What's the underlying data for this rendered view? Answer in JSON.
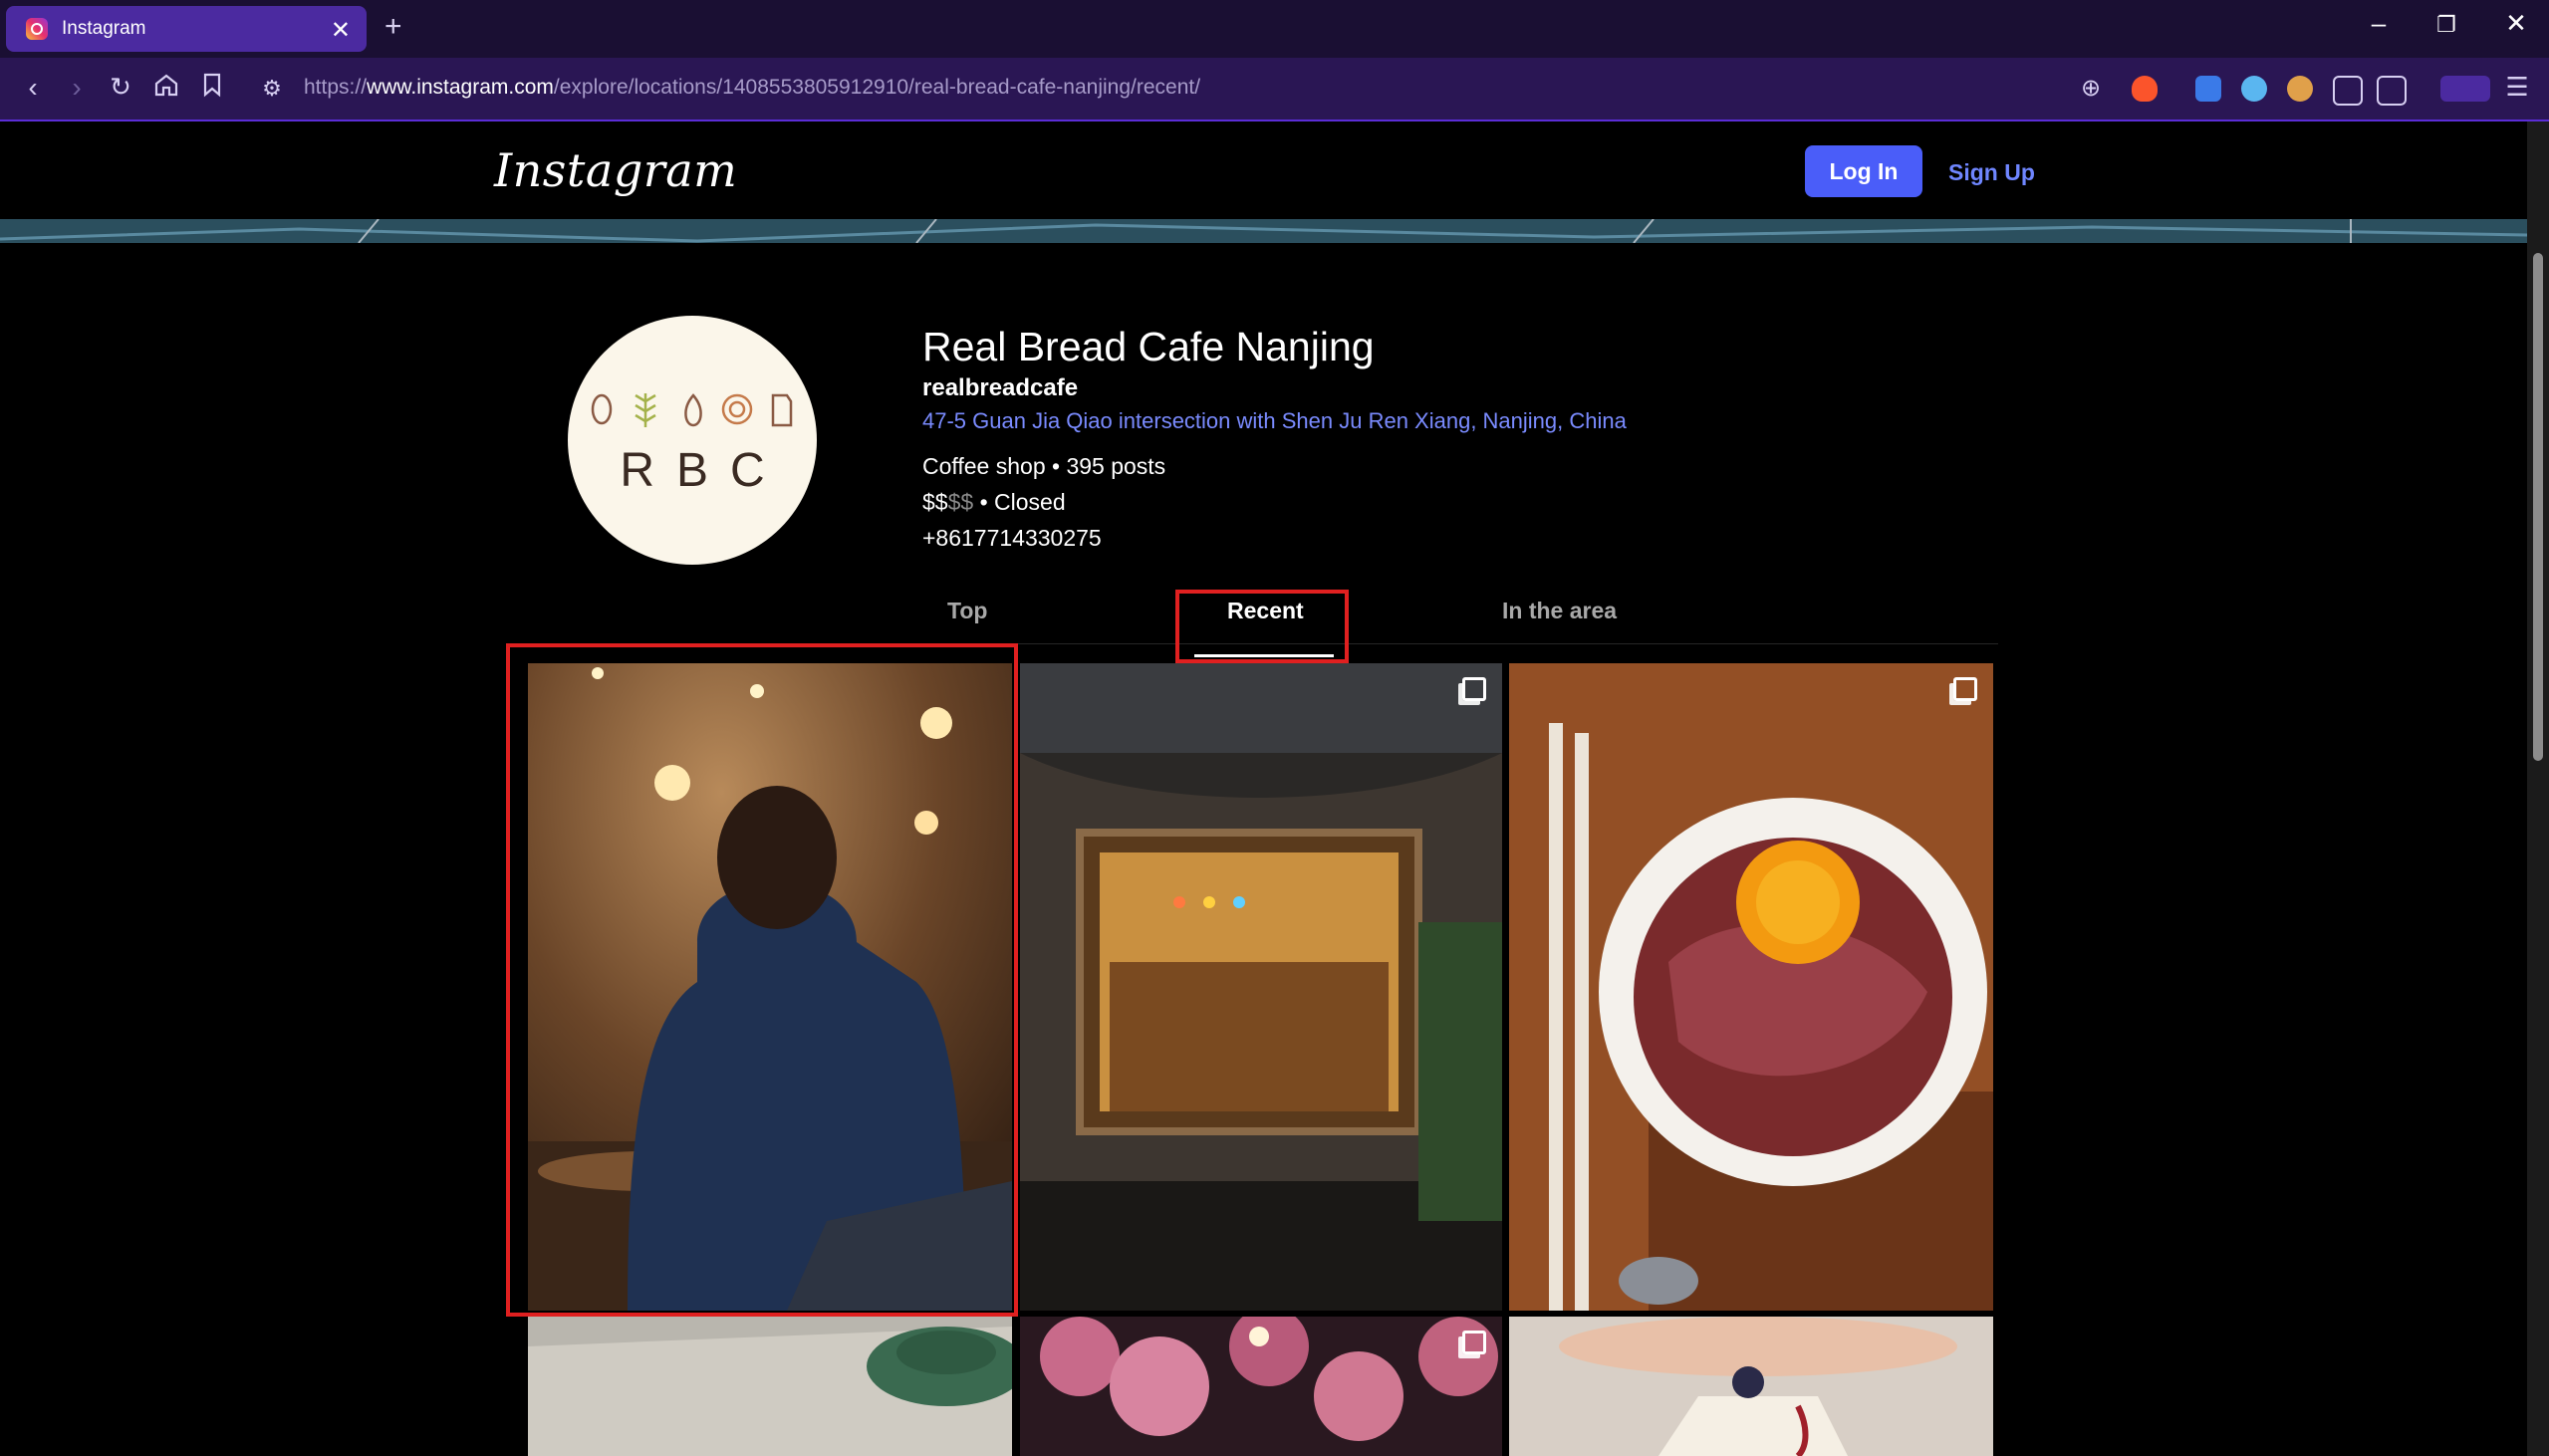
{
  "browser": {
    "tab_title": "Instagram",
    "url_prefix": "https://",
    "url_domain": "www.instagram.com",
    "url_path": "/explore/locations/1408553805912910/real-bread-cafe-nanjing/recent/"
  },
  "header": {
    "logo": "Instagram",
    "login_label": "Log In",
    "signup_label": "Sign Up"
  },
  "location": {
    "avatar_text": "RBC",
    "name": "Real Bread Cafe Nanjing",
    "username": "realbreadcafe",
    "address": "47-5 Guan Jia Qiao intersection with Shen Ju Ren Xiang, Nanjing, China",
    "category_posts": "Coffee shop • 395 posts",
    "price_active": "$$",
    "price_inactive": "$$",
    "status": " • Closed",
    "phone": "+8617714330275"
  },
  "tabs": [
    {
      "label": "Top",
      "active": false
    },
    {
      "label": "Recent",
      "active": true
    },
    {
      "label": "In the area",
      "active": false
    }
  ],
  "colors": {
    "accent": "#4a5df9",
    "link": "#7a8bff",
    "highlight": "#e02020",
    "tabbar": "#1a0f33",
    "toolbar": "#2a1654"
  }
}
